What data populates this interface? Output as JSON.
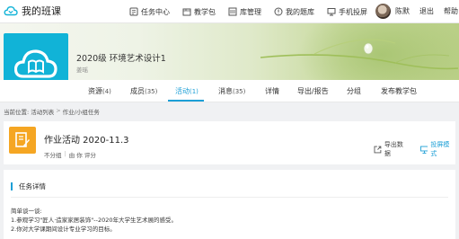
{
  "header": {
    "title": "我的班课",
    "nav": [
      {
        "label": "任务中心",
        "icon": "task-center-icon"
      },
      {
        "label": "教学包",
        "icon": "teaching-package-icon"
      },
      {
        "label": "库管理",
        "icon": "library-icon"
      },
      {
        "label": "我的题库",
        "icon": "question-bank-icon"
      },
      {
        "label": "手机投屏",
        "icon": "phone-cast-icon"
      }
    ],
    "user_name": "陈默",
    "logout": "退出",
    "help": "帮助"
  },
  "course": {
    "name": "2020级 环境艺术设计1",
    "teacher": "姜瑶",
    "cover_color": "#11b3d7"
  },
  "tabs": [
    {
      "label": "资源",
      "count": "(4)"
    },
    {
      "label": "成员",
      "count": "(35)"
    },
    {
      "label": "活动",
      "count": "(1)",
      "active": true
    },
    {
      "label": "消息",
      "count": "(35)"
    },
    {
      "label": "详情",
      "count": ""
    },
    {
      "label": "导出/报告",
      "count": ""
    },
    {
      "label": "分组",
      "count": ""
    },
    {
      "label": "发布教学包",
      "count": ""
    }
  ],
  "breadcrumb": {
    "prefix": "当前位置:",
    "items": [
      "活动列表",
      "作业/小组任务"
    ],
    "separator": ">"
  },
  "activity": {
    "title": "作业活动 2020-11.3",
    "grouping": "不分组",
    "scoring": "由 你 评分",
    "export_label": "导出数据",
    "projection_label": "投屏模式",
    "icon_color": "#f5a623"
  },
  "task_detail": {
    "heading": "任务详情",
    "lines": [
      "简单谈一谈:",
      "1.参观学习\"匠人·造家家居装饰\"--2020年大学生艺术展的感受。",
      "2.你对大学课期间设计专业学习的目标。"
    ]
  },
  "colors": {
    "accent": "#1c9fd6"
  }
}
